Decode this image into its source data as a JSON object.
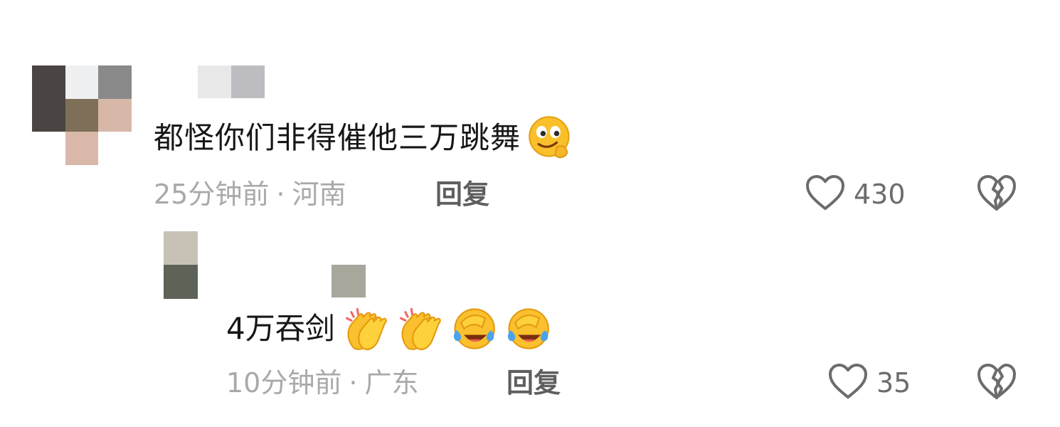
{
  "comments": [
    {
      "text": "都怪你们非得催他三万跳舞",
      "emojis": [
        "smirk-thinking-emoji"
      ],
      "time": "25分钟前",
      "separator": "·",
      "location": "河南",
      "reply_label": "回复",
      "like_count": "430"
    },
    {
      "text": "4万吞剑",
      "emojis": [
        "clapping-hands-emoji",
        "clapping-hands-emoji",
        "laughing-tears-emoji",
        "laughing-tears-emoji"
      ],
      "time": "10分钟前",
      "separator": "·",
      "location": "广东",
      "reply_label": "回复",
      "like_count": "35"
    }
  ],
  "colors": {
    "text": "#161616",
    "meta": "#a9a9a9",
    "reply": "#5e5e5e",
    "icon": "#6c6c6c"
  }
}
